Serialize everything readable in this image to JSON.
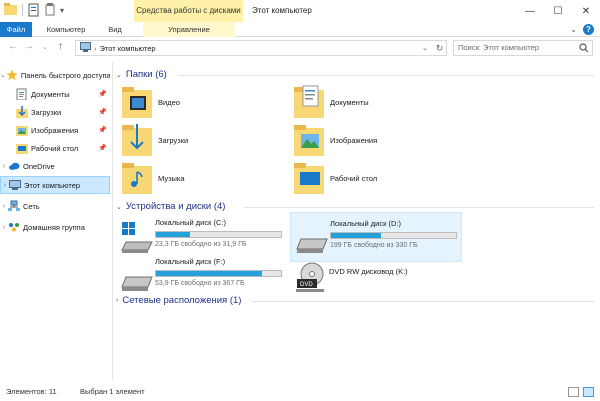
{
  "window": {
    "title": "Этот компьютер",
    "context_tab": "Средства работы с дисками",
    "controls": {
      "minimize": "—",
      "maximize": "☐",
      "close": "✕"
    }
  },
  "ribbon": {
    "tabs": [
      {
        "label": "Файл"
      },
      {
        "label": "Компьютер"
      },
      {
        "label": "Вид"
      },
      {
        "label": "Управление"
      }
    ],
    "help": "?"
  },
  "address": {
    "path": "Этот компьютер",
    "search_placeholder": "Поиск: Этот компьютер"
  },
  "nav": {
    "quick_access": "Панель быстрого доступа",
    "quick_items": [
      {
        "label": "Документы",
        "icon": "documents-icon"
      },
      {
        "label": "Загрузки",
        "icon": "downloads-icon"
      },
      {
        "label": "Изображения",
        "icon": "pictures-icon"
      },
      {
        "label": "Рабочий стол",
        "icon": "desktop-icon"
      }
    ],
    "onedrive": "OneDrive",
    "this_pc": "Этот компьютер",
    "network": "Сеть",
    "homegroup": "Домашняя группа"
  },
  "folders": {
    "header": "Папки (6)",
    "items": [
      {
        "label": "Видео"
      },
      {
        "label": "Документы"
      },
      {
        "label": "Загрузки"
      },
      {
        "label": "Изображения"
      },
      {
        "label": "Музыка"
      },
      {
        "label": "Рабочий стол"
      }
    ]
  },
  "devices": {
    "header": "Устройства и диски (4)",
    "drives": [
      {
        "name": "Локальный диск (C:)",
        "free": "23,3 ГБ свободно из 31,9 ГБ",
        "used_fraction": 0.27
      },
      {
        "name": "Локальный диск (D:)",
        "free": "199 ГБ свободно из 330 ГБ",
        "used_fraction": 0.4
      },
      {
        "name": "Локальный диск (F:)",
        "free": "53,9 ГБ свободно из 367 ГБ",
        "used_fraction": 0.85
      },
      {
        "name": "DVD RW дисковод (K:)"
      }
    ]
  },
  "network_locations": {
    "header": "Сетевые расположения (1)"
  },
  "status": {
    "items_count": "Элементов: 11",
    "selected": "Выбран 1 элемент"
  },
  "colors": {
    "accent": "#1979ca",
    "bar": "#26a0da",
    "folder": "#f8d775",
    "header": "#1e3287"
  }
}
